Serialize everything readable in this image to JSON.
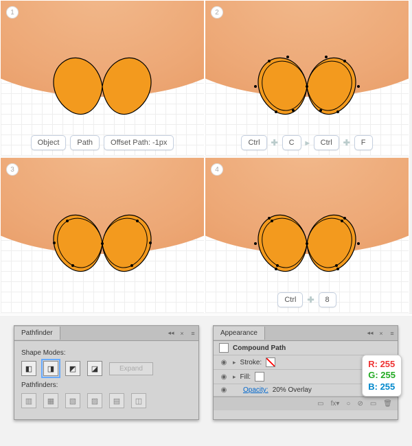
{
  "panes": {
    "p1": "1",
    "p2": "2",
    "p3": "3",
    "p4": "4",
    "row1": {
      "a": "Object",
      "b": "Path",
      "c": "Offset Path: -1px"
    },
    "row2": {
      "a": "Ctrl",
      "b": "C",
      "c": "Ctrl",
      "d": "F"
    },
    "row4": {
      "a": "Ctrl",
      "b": "8"
    }
  },
  "pathfinder": {
    "title": "Pathfinder",
    "shapeModes": "Shape Modes:",
    "pathfinders": "Pathfinders:",
    "expand": "Expand"
  },
  "appearance": {
    "title": "Appearance",
    "compound": "Compound Path",
    "stroke": "Stroke:",
    "fill": "Fill:",
    "opacity": "Opacity:",
    "opval": "20% Overlay"
  },
  "rgb": {
    "r": "R: 255",
    "g": "G: 255",
    "b": "B: 255"
  },
  "icons": {
    "eye": "◉",
    "tri": "▸",
    "menu": "≡",
    "coll": "◂◂",
    "close": "×",
    "fx": "fx▾",
    "circ": "○",
    "prohib": "⊘",
    "doc": "▭",
    "trash": "🗑"
  }
}
